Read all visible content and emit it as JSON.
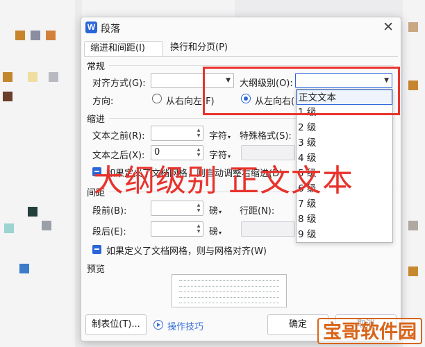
{
  "window": {
    "title": "段落"
  },
  "tabs": [
    {
      "label": "缩进和间距(I)",
      "active": true
    },
    {
      "label": "换行和分页(P)",
      "active": false
    }
  ],
  "general": {
    "header": "常规",
    "align_label": "对齐方式(G):",
    "align_value": "",
    "outline_label": "大纲级别(O):",
    "outline_value": "",
    "direction_label": "方向:",
    "rtl_label": "从右向左(F)",
    "ltr_label": "从左向右("
  },
  "indent": {
    "header": "缩进",
    "before_label": "文本之前(R):",
    "before_value": "",
    "before_unit": "字符",
    "after_label": "文本之后(X):",
    "after_value": "0",
    "after_unit": "字符",
    "special_label": "特殊格式(S):",
    "grid_checkbox": "如果定义了文档网格，则自动调整右缩进(D)"
  },
  "spacing": {
    "header": "间距",
    "before_label": "段前(B):",
    "before_value": "",
    "before_unit": "磅",
    "after_label": "段后(E):",
    "after_value": "",
    "after_unit": "磅",
    "line_label": "行距(N):",
    "grid_checkbox": "如果定义了文档网格，则与网格对齐(W)"
  },
  "preview": {
    "header": "预览"
  },
  "buttons": {
    "tabs": "制表位(T)...",
    "tips": "操作技巧",
    "ok": "确定",
    "cancel": "取消"
  },
  "outline_dropdown": {
    "items": [
      "正文文本",
      "1 级",
      "2 级",
      "3 级",
      "4 级",
      "5 级",
      "6 级",
      "7 级",
      "8 级",
      "9 级"
    ],
    "selected_index": 0
  },
  "annotation": {
    "overlay_text": "大纲级别 正文文本",
    "watermark": "宝哥软件园"
  },
  "colors": {
    "accent": "#2b66d9",
    "annotation_red": "#e8332d",
    "watermark_orange": "#d96418"
  }
}
